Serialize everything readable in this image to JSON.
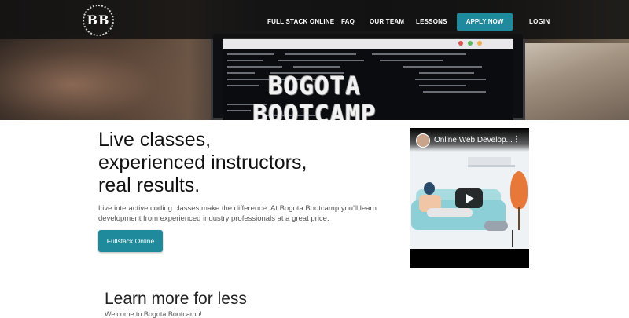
{
  "nav": {
    "logo": "BB",
    "items": [
      "FULL STACK ONLINE",
      "FAQ",
      "OUR TEAM",
      "LESSONS"
    ],
    "apply": "APPLY NOW",
    "login": "LOGIN",
    "accent": "#1f8a9c"
  },
  "hero": {
    "title": "BOGOTA BOOTCAMP"
  },
  "main": {
    "headline": [
      "Live classes,",
      "experienced instructors,",
      "real results."
    ],
    "description": "Live interactive coding classes make the difference. At Bogota Bootcamp you'll learn development from experienced industry professionals at a great price.",
    "cta": "Fullstack Online"
  },
  "video": {
    "title": "Online Web Develop...",
    "more_icon": "more-vert-icon",
    "play_icon": "play-icon"
  },
  "section": {
    "title": "Learn more for less",
    "subtitle": "Welcome to Bogota Bootcamp!"
  }
}
